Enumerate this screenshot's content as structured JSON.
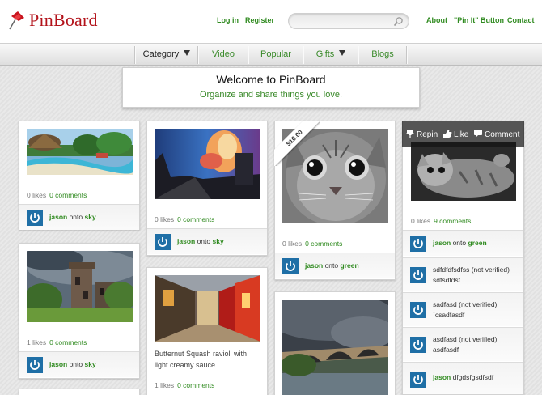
{
  "header": {
    "logo_text": "PinBoard",
    "links": {
      "login": "Log in",
      "register": "Register",
      "about": "About",
      "pin_it": "\"Pin It\" Button",
      "contact": "Contact"
    },
    "search_placeholder": ""
  },
  "nav": {
    "items": [
      {
        "label": "Category",
        "dropdown": true
      },
      {
        "label": "Video"
      },
      {
        "label": "Popular"
      },
      {
        "label": "Gifts",
        "dropdown": true
      },
      {
        "label": "Blogs"
      }
    ]
  },
  "welcome": {
    "title": "Welcome to PinBoard",
    "subtitle": "Organize and share things you love."
  },
  "icons": [
    "pin-logo-icon",
    "search-icon",
    "power-avatar-icon",
    "repin-icon",
    "like-icon",
    "comment-icon"
  ],
  "colors": {
    "brand_red": "#b3121a",
    "link_green": "#2f8a1f",
    "avatar_blue": "#1f6fa6"
  },
  "pins": {
    "resort": {
      "likes": "0 likes",
      "comments": "0 comments",
      "user": "jason",
      "onto": "onto",
      "board": "sky"
    },
    "castle": {
      "likes": "1 likes",
      "comments": "0 comments",
      "user": "jason",
      "onto": "onto",
      "board": "sky"
    },
    "sunset": {
      "likes": "0 likes",
      "comments": "0 comments",
      "user": "jason",
      "onto": "onto",
      "board": "sky"
    },
    "street": {
      "description_line1": "Butternut Squash ravioli with",
      "description_line2": "light creamy sauce",
      "likes": "1 likes",
      "comments": "0 comments"
    },
    "cat": {
      "price": "$10.00",
      "likes": "0 likes",
      "comments": "0 comments",
      "user": "jason",
      "onto": "onto",
      "board": "green"
    },
    "kitten": {
      "actions": {
        "repin": "Repin",
        "like": "Like",
        "comment": "Comment"
      },
      "likes": "0 likes",
      "comments": "9 comments",
      "user": "jason",
      "onto": "onto",
      "board": "green",
      "comment_list": [
        {
          "line1": "sdfdfdfsdfss (not verified)",
          "line2": "sdfsdfdsf"
        },
        {
          "line1": "sadfasd (not verified)",
          "line2": "`csadfasdf"
        },
        {
          "line1": "asdfasd (not verified)",
          "line2": "asdfasdf"
        },
        {
          "user": "jason",
          "text": "dfgdsfgsdfsdf"
        }
      ]
    }
  }
}
